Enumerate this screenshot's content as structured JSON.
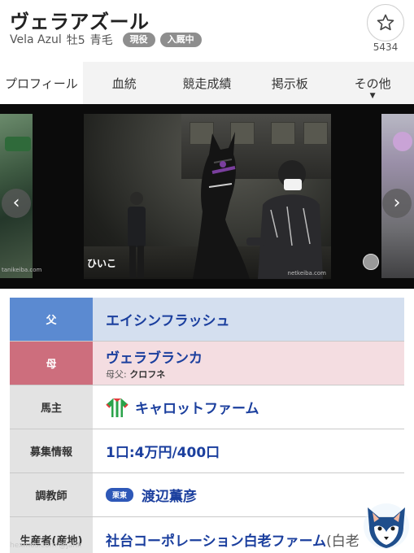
{
  "header": {
    "title": "ヴェラアズール",
    "english_name": "Vela Azul",
    "sex_age": "牡5",
    "coat": "青毛",
    "badges": [
      "現役",
      "入厩中"
    ],
    "favorite_count": "5434"
  },
  "tabs": [
    {
      "label": "プロフィール",
      "active": true
    },
    {
      "label": "血統",
      "active": false
    },
    {
      "label": "競走成績",
      "active": false
    },
    {
      "label": "掲示板",
      "active": false
    },
    {
      "label": "その他",
      "active": false,
      "caret": "▼"
    }
  ],
  "gallery": {
    "photo_credit": "ひいこ",
    "watermark_main": "netkeiba.com",
    "watermark_left": "tanikeiba.com",
    "prev_arrow": "‹",
    "next_arrow": "›"
  },
  "profile": {
    "father": {
      "label": "父",
      "value": "エイシンフラッシュ"
    },
    "mother": {
      "label": "母",
      "value": "ヴェラブランカ",
      "sub_label": "母父:",
      "sub_value": "クロフネ"
    },
    "owner": {
      "label": "馬主",
      "value": "キャロットファーム"
    },
    "recruit": {
      "label": "募集情報",
      "value": "1口:4万円/400口"
    },
    "trainer": {
      "label": "調教師",
      "region": "栗東",
      "value": "渡辺薫彦"
    },
    "breeder": {
      "label": "生産者(産地)",
      "value": "社台コーポレーション白老ファーム",
      "place": "(白老"
    }
  },
  "footer_watermark": "hexmos.com @jank",
  "colors": {
    "father_header": "#5b8ad1",
    "mother_header": "#cd6e7d",
    "link": "#1b3f9e",
    "region_badge": "#2e58b8",
    "badge_gray": "#8e8e8e"
  },
  "icons": {
    "favorite": "star-outline-icon",
    "silks": "jockey-silks-icon",
    "mascot": "fox-mascot-icon"
  }
}
